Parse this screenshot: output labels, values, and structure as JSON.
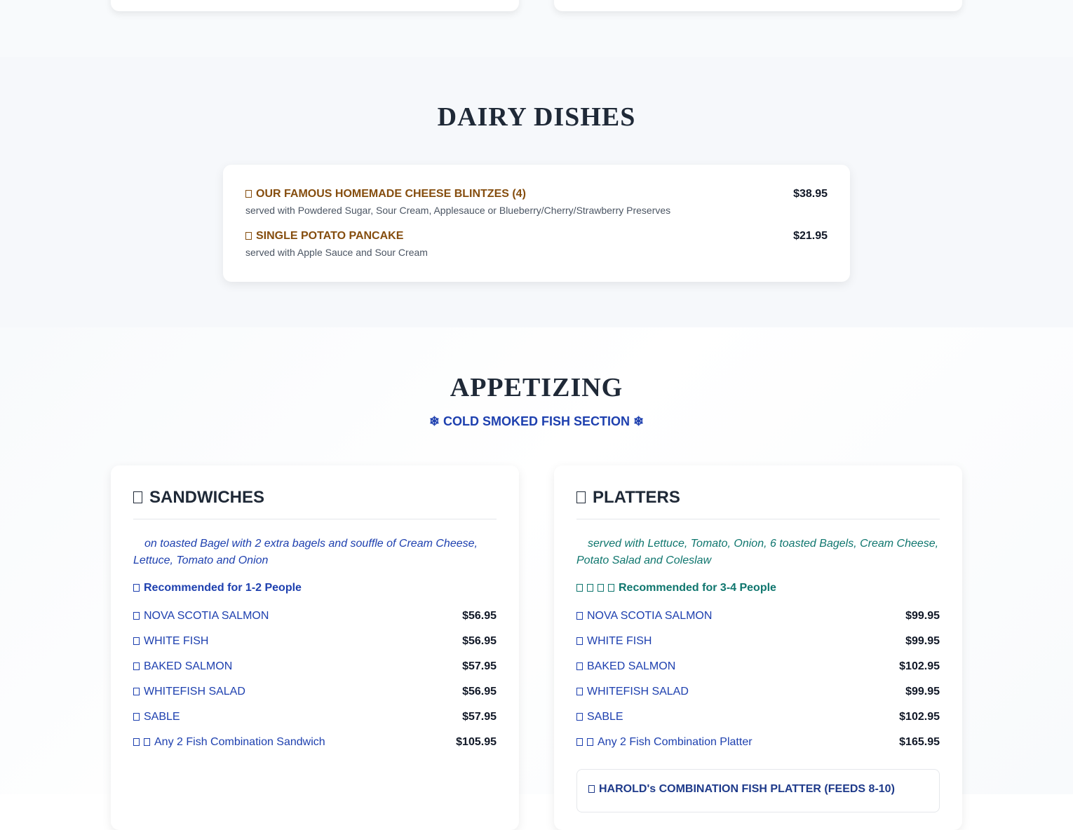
{
  "dairy": {
    "title": "DAIRY DISHES",
    "items": [
      {
        "name": "OUR FAMOUS HOMEMADE CHEESE BLINTZES (4)",
        "price": "$38.95",
        "description": "served with Powdered Sugar, Sour Cream, Applesauce or Blueberry/Cherry/Strawberry Preserves"
      },
      {
        "name": "SINGLE POTATO PANCAKE",
        "price": "$21.95",
        "description": "served with Apple Sauce and Sour Cream"
      }
    ]
  },
  "appetizing": {
    "title": "APPETIZING",
    "subtitle": "❄ COLD SMOKED FISH SECTION ❄",
    "sandwiches": {
      "title": "SANDWICHES",
      "intro": "on toasted Bagel with 2 extra bagels and souffle of Cream Cheese, Lettuce, Tomato and Onion",
      "recommendation": "Recommended for 1-2 People",
      "items": [
        {
          "name": "NOVA SCOTIA SALMON",
          "price": "$56.95"
        },
        {
          "name": "WHITE FISH",
          "price": "$56.95"
        },
        {
          "name": "BAKED SALMON",
          "price": "$57.95"
        },
        {
          "name": "WHITEFISH SALAD",
          "price": "$56.95"
        },
        {
          "name": "SABLE",
          "price": "$57.95"
        },
        {
          "name": "Any 2 Fish Combination Sandwich",
          "price": "$105.95"
        }
      ]
    },
    "platters": {
      "title": "PLATTERS",
      "intro": "served with Lettuce, Tomato, Onion, 6 toasted Bagels, Cream Cheese, Potato Salad and Coleslaw",
      "recommendation": "Recommended for 3-4 People",
      "items": [
        {
          "name": "NOVA SCOTIA SALMON",
          "price": "$99.95"
        },
        {
          "name": "WHITE FISH",
          "price": "$99.95"
        },
        {
          "name": "BAKED SALMON",
          "price": "$102.95"
        },
        {
          "name": "WHITEFISH SALAD",
          "price": "$99.95"
        },
        {
          "name": "SABLE",
          "price": "$102.95"
        },
        {
          "name": "Any 2 Fish Combination Platter",
          "price": "$165.95"
        }
      ],
      "combo_title": "HAROLD's COMBINATION FISH PLATTER (FEEDS 8-10)"
    }
  },
  "colors": {
    "dairy_item": "#854d0e",
    "sandwich_accent": "#1e40af",
    "platter_accent": "#0f766e",
    "heading": "#1f2937"
  }
}
